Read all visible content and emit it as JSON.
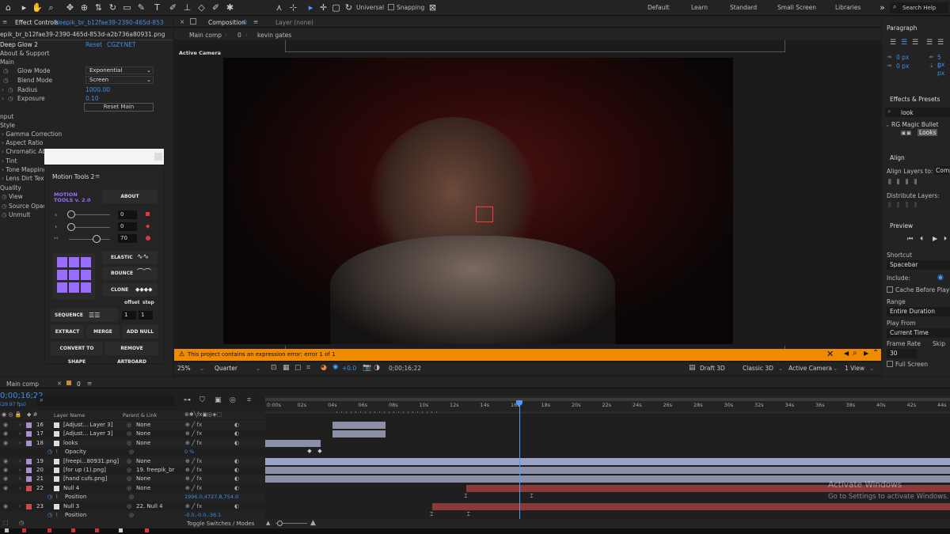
{
  "toolbar": {
    "universal_label": "Universal",
    "snapping_label": "Snapping",
    "workspaces": [
      "Default",
      "Learn",
      "Standard",
      "Small Screen",
      "Libraries"
    ],
    "search_help_label": "Search Help"
  },
  "effect_controls": {
    "tab_label": "Effect Controls",
    "tab_file": "freepik_br_b12fae39-2390-465d-853",
    "file_path": "epik_br_b12fae39-2390-465d-853d-a2b736a80931.png",
    "effect_name": "Deep Glow 2",
    "reset_label": "Reset",
    "cgzy_label": "CGZY.NET",
    "about_support": "About & Support",
    "main_label": "Main",
    "glow_mode_label": "Glow Mode",
    "glow_mode_value": "Exponential",
    "blend_mode_label": "Blend Mode",
    "blend_mode_value": "Screen",
    "radius_label": "Radius",
    "radius_value": "1000.00",
    "exposure_label": "Exposure",
    "exposure_value": "0.10",
    "reset_main_label": "Reset Main",
    "input_label": "nput",
    "style_label": "Style",
    "gamma_label": "Gamma Correction",
    "aspect_label": "Aspect Ratio",
    "chromatic_label": "Chromatic Ab",
    "tint_label": "Tint",
    "tone_label": "Tone Mapping",
    "lens_label": "Lens Dirt Text",
    "quality_label": "Quality",
    "view_label": "View",
    "source_opacity_label": "Source Opacit",
    "unmult_label": "Unmult"
  },
  "motion_tools": {
    "title": "Motion Tools 2",
    "logo_line1": "MOTION",
    "logo_line2": "TOOLS v. 2.0",
    "about_label": "ABOUT",
    "slider1_value": "0",
    "slider2_value": "0",
    "slider3_value": "70",
    "slider3_fill": 0.7,
    "elastic_label": "ELASTIC",
    "bounce_label": "BOUNCE",
    "clone_label": "CLONE",
    "offset_label": "offset",
    "step_label": "step",
    "sequence_label": "SEQUENCE",
    "offset_value": "1",
    "step_value": "1",
    "extract_label": "EXTRACT",
    "merge_label": "MERGE",
    "add_null_label": "ADD NULL",
    "convert_label": "CONVERT TO SHAPE",
    "remove_artboard_label": "REMOVE ARTBOARD"
  },
  "composition": {
    "tab_label": "Composition",
    "tab_suffix": "0",
    "layer_label": "Layer (none)",
    "breadcrumb_main": "Main comp",
    "breadcrumb_num": "0",
    "breadcrumb_sub": "kevin gates",
    "viewer_label": "Active Camera",
    "error_text": "This project contains an expression error: error 1 of 1",
    "zoom_value": "25%",
    "resolution_value": "Quarter",
    "exposure_value": "+0.0",
    "timecode": "0;00;16;22",
    "renderer_label": "Draft 3D",
    "renderer_mode": "Classic 3D",
    "camera_value": "Active Camera",
    "view_value": "1 View"
  },
  "right_panel": {
    "paragraph_title": "Paragraph",
    "indent_values": [
      "0 px",
      "0 px",
      "5 px",
      "0 px"
    ],
    "effects_presets_title": "Effects & Presets",
    "search_value": "look",
    "rg_item": "RG Magic Bullet",
    "looks_item": "Looks",
    "align_title": "Align",
    "align_layers_to": "Align Layers to:",
    "align_target": "Comp",
    "distribute_label": "Distribute Layers:",
    "preview_title": "Preview",
    "shortcut_label": "Shortcut",
    "shortcut_value": "Spacebar",
    "include_label": "Include:",
    "cache_label": "Cache Before Playback",
    "range_label": "Range",
    "range_value": "Entire Duration",
    "play_from_label": "Play From",
    "play_from_value": "Current Time",
    "frame_rate_label": "Frame Rate",
    "skip_label": "Skip",
    "frame_rate_value": "30",
    "full_screen_label": "Full Screen"
  },
  "timeline": {
    "tab_main": "Main comp",
    "tab_zero": "0",
    "timecode": "0;00;16;22",
    "fps": "(29.97 fps)",
    "layer_name_header": "Layer Name",
    "parent_header": "Parent & Link",
    "toggle_label": "Toggle Switches / Modes",
    "time_ticks": [
      "0:00s",
      "02s",
      "04s",
      "06s",
      "08s",
      "10s",
      "12s",
      "14s",
      "16s",
      "18s",
      "20s",
      "22s",
      "24s",
      "26s",
      "28s",
      "30s",
      "32s",
      "34s",
      "36s",
      "38s",
      "40s",
      "42s",
      "44s"
    ],
    "playhead_fraction": 0.371,
    "layers": [
      {
        "num": "16",
        "name": "[Adjust... Layer 3]",
        "parent": "None",
        "color": "#a98fd0",
        "start": 0.098,
        "end": 0.176,
        "bar": "#8b8fa8"
      },
      {
        "num": "17",
        "name": "[Adjust... Layer 3]",
        "parent": "None",
        "color": "#a98fd0",
        "start": 0.098,
        "end": 0.176,
        "bar": "#8b8fa8"
      },
      {
        "num": "18",
        "name": "looks",
        "parent": "None",
        "color": "#a98fd0",
        "start": 0.0,
        "end": 0.081,
        "bar": "#8b8fa8"
      },
      {
        "num": "",
        "name": "Opacity",
        "parent": "",
        "color": "",
        "sub": "0 %",
        "start": 0,
        "end": 0,
        "bar": ""
      },
      {
        "num": "19",
        "name": "[freepi...80931.png]",
        "parent": "None",
        "color": "#a98fd0",
        "start": 0.0,
        "end": 1.0,
        "bar": "#9da3c8"
      },
      {
        "num": "20",
        "name": "[for up (1).png]",
        "parent": "19. freepik_br",
        "color": "#a98fd0",
        "start": 0.0,
        "end": 1.0,
        "bar": "#8b8fa8"
      },
      {
        "num": "21",
        "name": "[hand cufs.png]",
        "parent": "None",
        "color": "#a98fd0",
        "start": 0.0,
        "end": 1.0,
        "bar": "#8b8fa8"
      },
      {
        "num": "22",
        "name": "Null 4",
        "parent": "None",
        "color": "#d04848",
        "start": 0.294,
        "end": 1.0,
        "bar": "#8a3a3a"
      },
      {
        "num": "",
        "name": "Position",
        "parent": "",
        "color": "",
        "sub": "1996.0,4727.8,754.0",
        "start": 0,
        "end": 0,
        "bar": ""
      },
      {
        "num": "23",
        "name": "Null 3",
        "parent": "22. Null 4",
        "color": "#d04848",
        "start": 0.244,
        "end": 1.0,
        "bar": "#8a3a3a"
      },
      {
        "num": "",
        "name": "Position",
        "parent": "",
        "color": "",
        "sub": "-0.0,-0.0,-36.1",
        "start": 0,
        "end": 0,
        "bar": ""
      }
    ]
  },
  "watermark": {
    "line1": "Activate Windows",
    "line2": "Go to Settings to activate Windows."
  }
}
